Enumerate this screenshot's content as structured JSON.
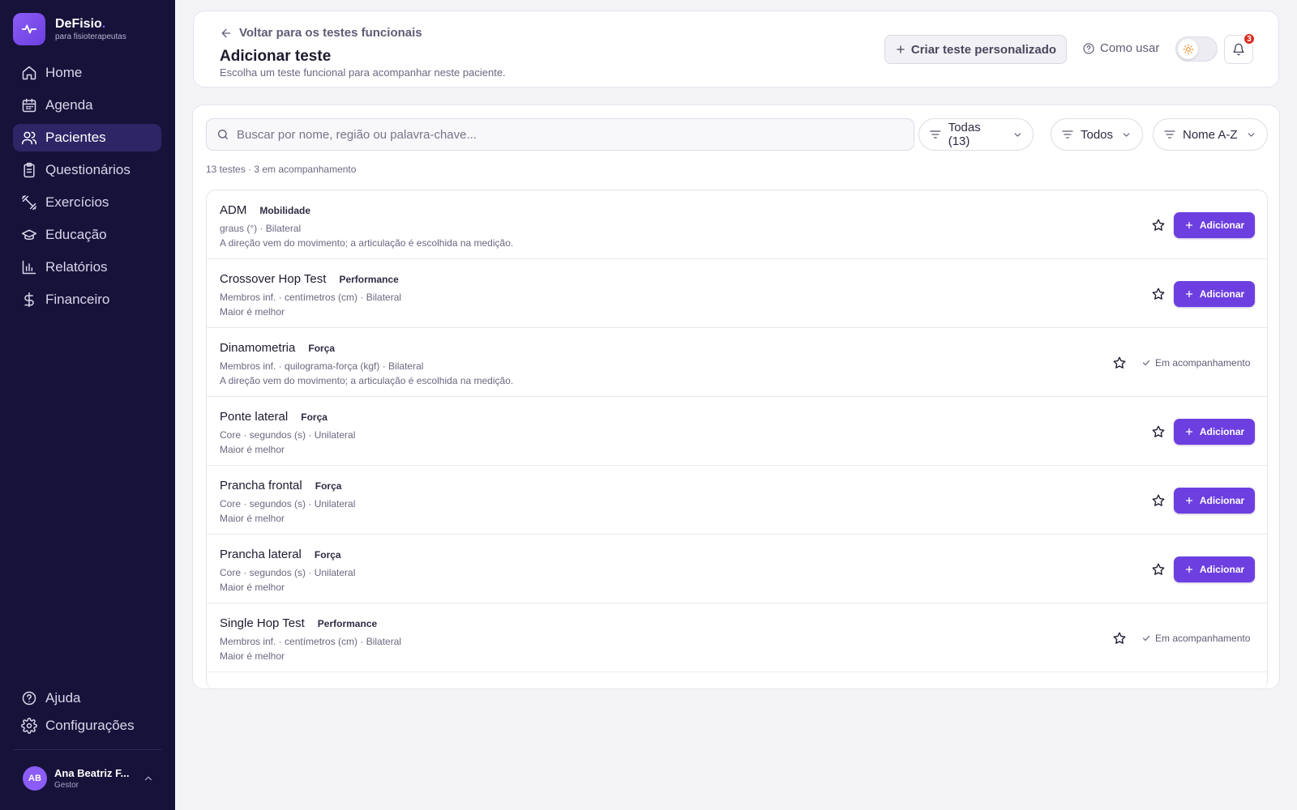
{
  "brand": {
    "name": "DeFisio",
    "dot": ".",
    "subtitle": "para fisioterapeutas"
  },
  "sidebar": {
    "items": [
      {
        "label": "Home",
        "icon": "home-icon"
      },
      {
        "label": "Agenda",
        "icon": "calendar-icon"
      },
      {
        "label": "Pacientes",
        "icon": "users-icon",
        "active": true
      },
      {
        "label": "Questionários",
        "icon": "clipboard-icon"
      },
      {
        "label": "Exercícios",
        "icon": "dumbbell-icon"
      },
      {
        "label": "Educação",
        "icon": "graduation-cap-icon"
      },
      {
        "label": "Relatórios",
        "icon": "bar-chart-icon"
      },
      {
        "label": "Financeiro",
        "icon": "dollar-icon"
      }
    ],
    "bottom": [
      {
        "label": "Ajuda",
        "icon": "help-circle-icon"
      },
      {
        "label": "Configurações",
        "icon": "gear-icon"
      }
    ],
    "user": {
      "initials": "AB",
      "name": "Ana Beatriz F...",
      "role": "Gestor"
    }
  },
  "header": {
    "back_label": "Voltar para os testes funcionais",
    "title": "Adicionar teste",
    "subtitle": "Escolha um teste funcional para acompanhar neste paciente.",
    "create_label": "Criar teste personalizado",
    "how_to_label": "Como usar",
    "notification_count": "3"
  },
  "search": {
    "placeholder": "Buscar por nome, região ou palavra-chave...",
    "value": ""
  },
  "filters": {
    "category": "Todas (13)",
    "region": "Todos",
    "sort": "Nome A-Z"
  },
  "summary": "13 testes · 3 em acompanhamento",
  "add_label": "Adicionar",
  "tracking_label": "Em acompanhamento",
  "colors": {
    "accent": "#6d3fe0",
    "sidebar": "#17123a",
    "badge": "#d92d20"
  },
  "tests": [
    {
      "name": "ADM",
      "tag": "Mobilidade",
      "meta": "graus (°) · Bilateral",
      "note": "A direção vem do movimento; a articulação é escolhida na medição.",
      "tracking": false
    },
    {
      "name": "Crossover Hop Test",
      "tag": "Performance",
      "meta": "Membros inf. · centímetros (cm) · Bilateral",
      "note": "Maior é melhor",
      "tracking": false
    },
    {
      "name": "Dinamometria",
      "tag": "Força",
      "meta": "Membros inf. · quilograma-força (kgf) · Bilateral",
      "note": "A direção vem do movimento; a articulação é escolhida na medição.",
      "tracking": true
    },
    {
      "name": "Ponte lateral",
      "tag": "Força",
      "meta": "Core · segundos (s) · Unilateral",
      "note": "Maior é melhor",
      "tracking": false
    },
    {
      "name": "Prancha frontal",
      "tag": "Força",
      "meta": "Core · segundos (s) · Unilateral",
      "note": "Maior é melhor",
      "tracking": false
    },
    {
      "name": "Prancha lateral",
      "tag": "Força",
      "meta": "Core · segundos (s) · Unilateral",
      "note": "Maior é melhor",
      "tracking": false
    },
    {
      "name": "Single Hop Test",
      "tag": "Performance",
      "meta": "Membros inf. · centímetros (cm) · Bilateral",
      "note": "Maior é melhor",
      "tracking": true
    }
  ]
}
